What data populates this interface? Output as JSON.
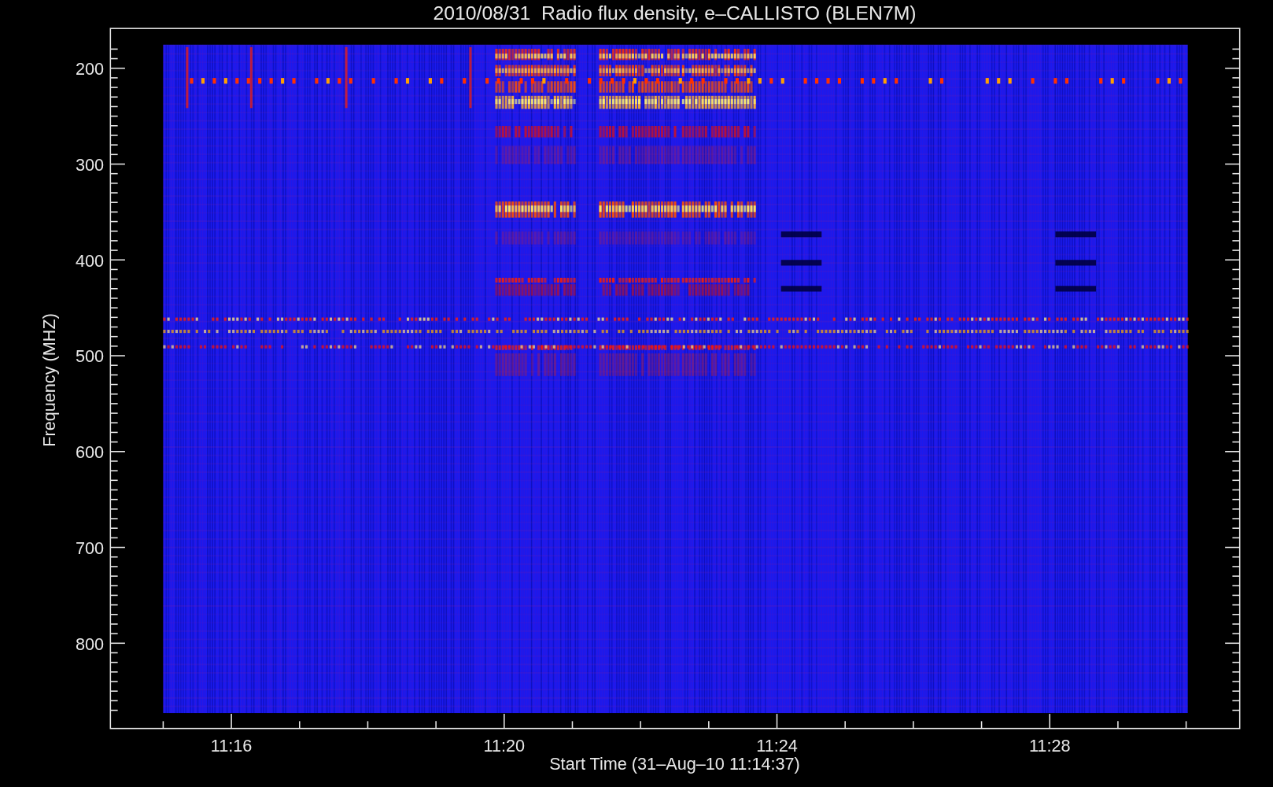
{
  "title": "2010/08/31  Radio flux density, e–CALLISTO (BLEN7M)",
  "y_axis": {
    "label": "Frequency (MHZ)",
    "ticks": [
      "200",
      "300",
      "400",
      "500",
      "600",
      "700",
      "800"
    ]
  },
  "x_axis": {
    "label": "Start Time (31–Aug–10 11:14:37)",
    "ticks": [
      "11:16",
      "11:20",
      "11:24",
      "11:28"
    ]
  }
}
